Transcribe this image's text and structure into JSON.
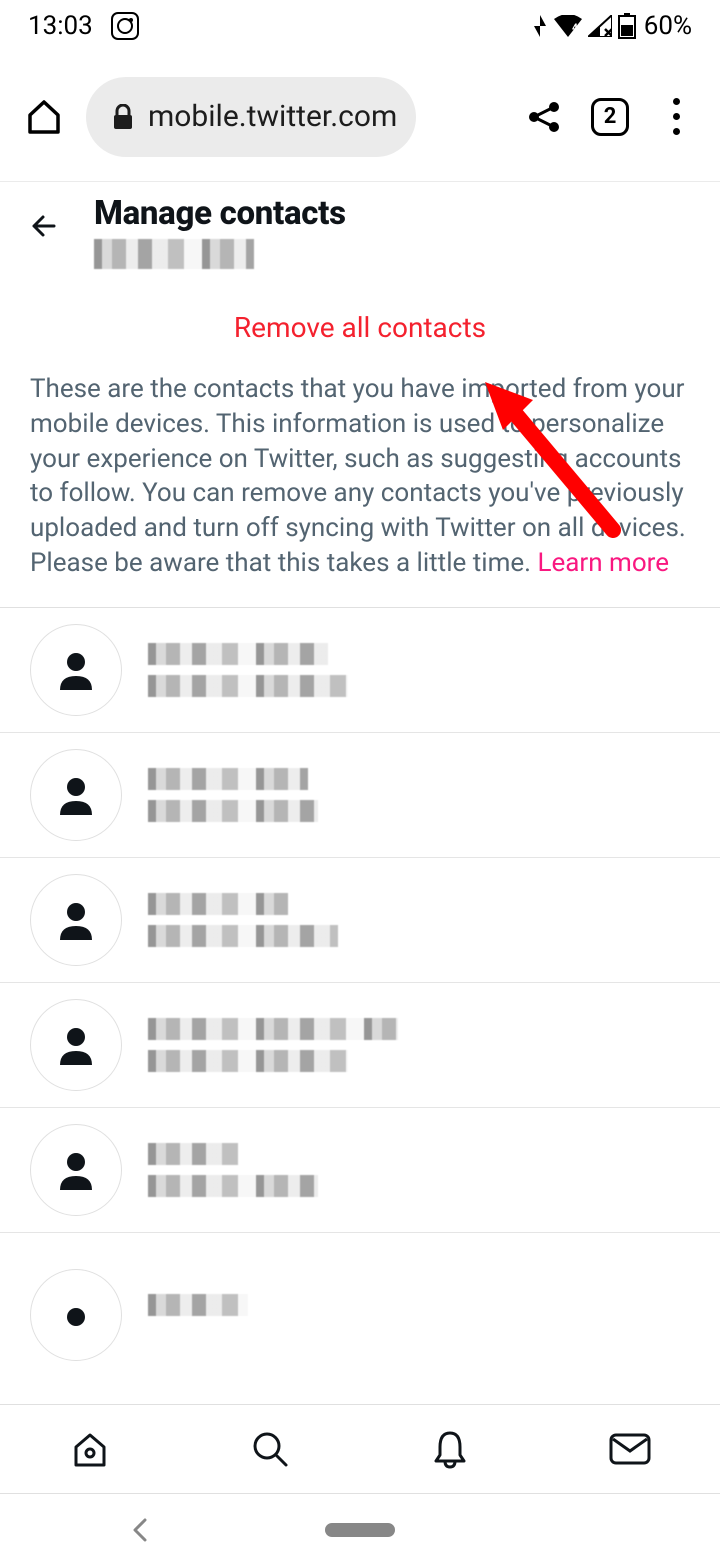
{
  "status": {
    "time": "13:03",
    "battery": "60%"
  },
  "browser": {
    "url": "mobile.twitter.com",
    "tab_count": "2"
  },
  "header": {
    "title": "Manage contacts"
  },
  "actions": {
    "remove_all": "Remove all contacts"
  },
  "description": {
    "text": "These are the contacts that you have imported from your mobile devices. This information is used to personalize your experience on Twitter, such as suggesting accounts to follow. You can remove any contacts you've previously uploaded and turn off syncing with Twitter on all devices. Please be aware that this takes a little time. ",
    "learn_more": "Learn more"
  }
}
